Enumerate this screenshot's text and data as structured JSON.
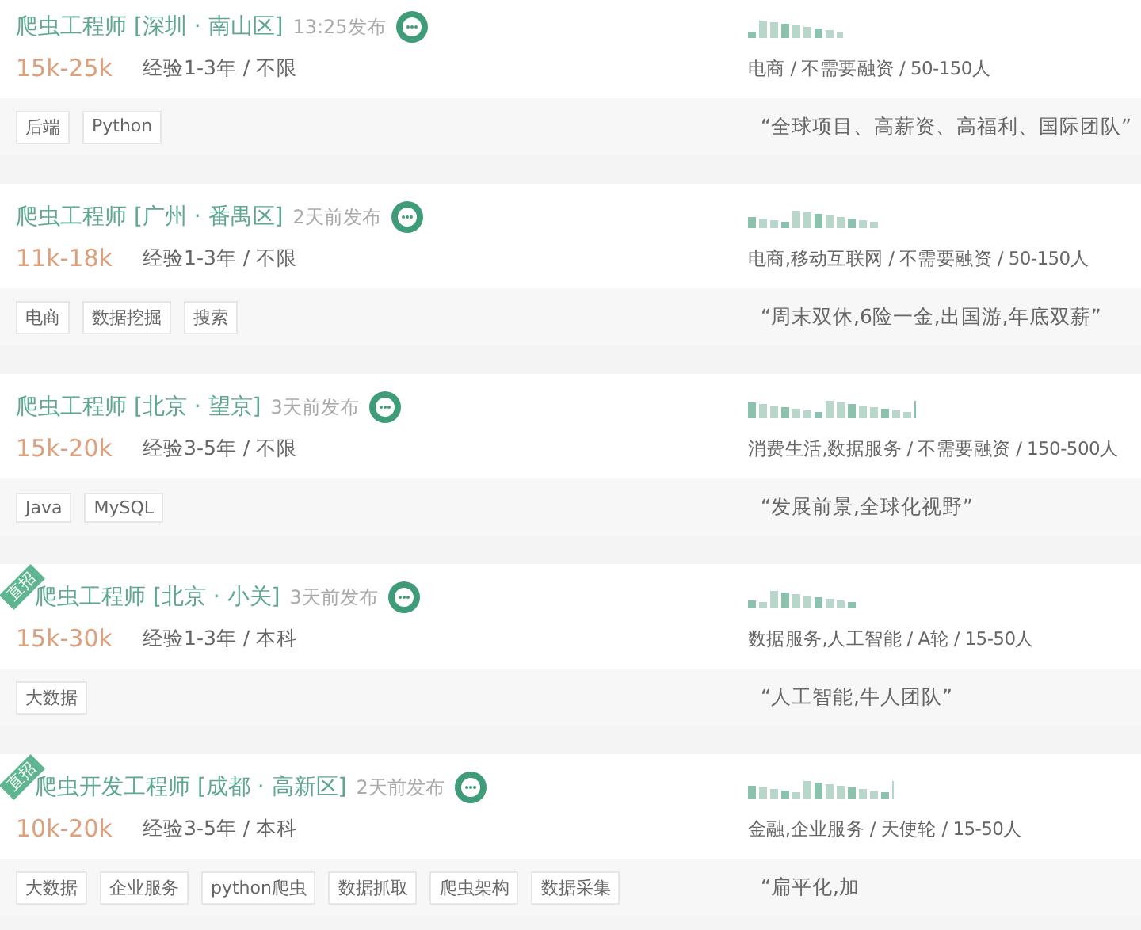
{
  "jobs": [
    {
      "title": "爬虫工程师 [深圳 · 南山区]",
      "posted": "13:25发布",
      "salary": "15k-25k",
      "requirements": "经验1-3年 / 不限",
      "tags": [
        "后端",
        "Python"
      ],
      "company_info": "电商 / 不需要融资 / 50-150人",
      "slogan": "“全球项目、高薪资、高福利、国际团队”"
    },
    {
      "title": "爬虫工程师 [广州 · 番禺区]",
      "posted": "2天前发布",
      "salary": "11k-18k",
      "requirements": "经验1-3年 / 不限",
      "tags": [
        "电商",
        "数据挖掘",
        "搜索"
      ],
      "company_info": "电商,移动互联网 / 不需要融资 / 50-150人",
      "slogan": "“周末双休,6险一金,出国游,年底双薪”"
    },
    {
      "title": "爬虫工程师 [北京 · 望京]",
      "posted": "3天前发布",
      "salary": "15k-20k",
      "requirements": "经验3-5年 / 不限",
      "tags": [
        "Java",
        "MySQL"
      ],
      "company_info": "消费生活,数据服务 / 不需要融资 / 150-500人",
      "slogan": "“发展前景,全球化视野”"
    },
    {
      "title": "爬虫工程师 [北京 · 小关]",
      "badge": "直招",
      "posted": "3天前发布",
      "salary": "15k-30k",
      "requirements": "经验1-3年 / 本科",
      "tags": [
        "大数据"
      ],
      "company_info": "数据服务,人工智能 / A轮 / 15-50人",
      "slogan": "“人工智能,牛人团队”"
    },
    {
      "title": "爬虫开发工程师 [成都 · 高新区]",
      "badge": "直招",
      "posted": "2天前发布",
      "salary": "10k-20k",
      "requirements": "经验3-5年 / 本科",
      "tags": [
        "大数据",
        "企业服务",
        "python爬虫",
        "数据抓取",
        "爬虫架构",
        "数据采集"
      ],
      "company_info": "金融,企业服务 / 天使轮 / 15-50人",
      "slogan": "“扁平化,加"
    }
  ]
}
